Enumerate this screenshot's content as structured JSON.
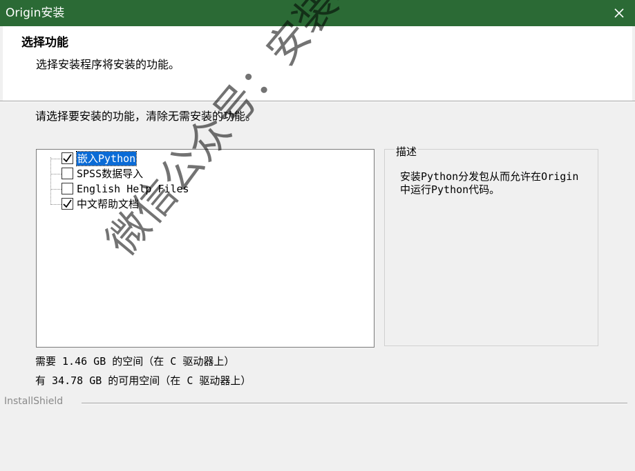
{
  "window": {
    "title": "Origin安装"
  },
  "header": {
    "title": "选择功能",
    "subtitle": "选择安装程序将安装的功能。"
  },
  "instruction": "请选择要安装的功能，清除无需安装的功能。",
  "features": [
    {
      "label": "嵌入Python",
      "checked": true,
      "selected": true
    },
    {
      "label": "SPSS数据导入",
      "checked": false,
      "selected": false
    },
    {
      "label": "English Help Files",
      "checked": false,
      "selected": false
    },
    {
      "label": "中文帮助文档",
      "checked": true,
      "selected": false
    }
  ],
  "description": {
    "title": "描述",
    "text": "安装Python分发包从而允许在Origin中运行Python代码。"
  },
  "space": {
    "required": "需要 1.46 GB 的空间（在 C 驱动器上）",
    "available": "有 34.78 GB 的可用空间（在 C 驱动器上）"
  },
  "footer": {
    "brand": "InstallShield"
  },
  "watermark": "微信公众号：安装软件指南",
  "colors": {
    "titlebar": "#2b6a35",
    "selection": "#0a6bd6"
  }
}
